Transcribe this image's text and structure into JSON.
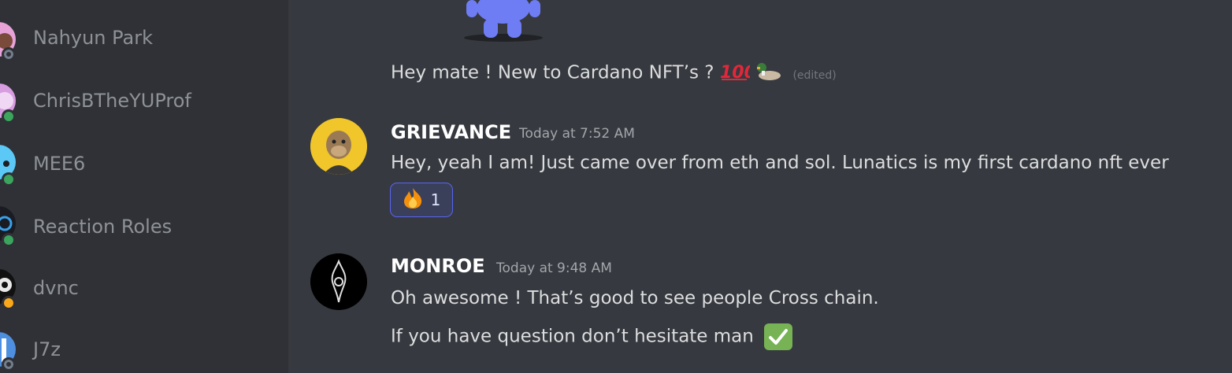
{
  "members": [
    {
      "name": "Nahyun Park",
      "status": "offline",
      "avatar_color": "#e7a3d8"
    },
    {
      "name": "ChrisBTheYUProf",
      "status": "online",
      "avatar_color": "#d79de0"
    },
    {
      "name": "MEE6",
      "status": "online",
      "avatar_color": "#5bc8f5"
    },
    {
      "name": "Reaction Roles",
      "status": "online",
      "avatar_color": "#1a1c22"
    },
    {
      "name": "dvnc",
      "status": "idle",
      "avatar_color": "#111111"
    },
    {
      "name": "J7z",
      "status": "offline",
      "avatar_color": "#4f8fe0"
    }
  ],
  "messages": {
    "prev_text": "Hey mate ! New to Cardano NFT’s ?",
    "prev_edited": "(edited)",
    "grievance": {
      "author": "GRIEVANCE",
      "timestamp": "Today at 7:52 AM",
      "text": "Hey, yeah I am! Just came over from eth and sol. Lunatics is my first cardano nft ever",
      "reaction_emoji": "fire",
      "reaction_count": "1"
    },
    "monroe": {
      "author": "MONROE",
      "timestamp": "Today at 9:48 AM",
      "line1": "Oh awesome ! That’s good to see people Cross chain.",
      "line2": "If you have question don’t hesitate man"
    }
  },
  "colors": {
    "sidebar_bg": "#2f3136",
    "chat_bg": "#36393f",
    "reaction_border": "#5865f2",
    "online": "#3ba55d",
    "idle": "#faa81a"
  }
}
